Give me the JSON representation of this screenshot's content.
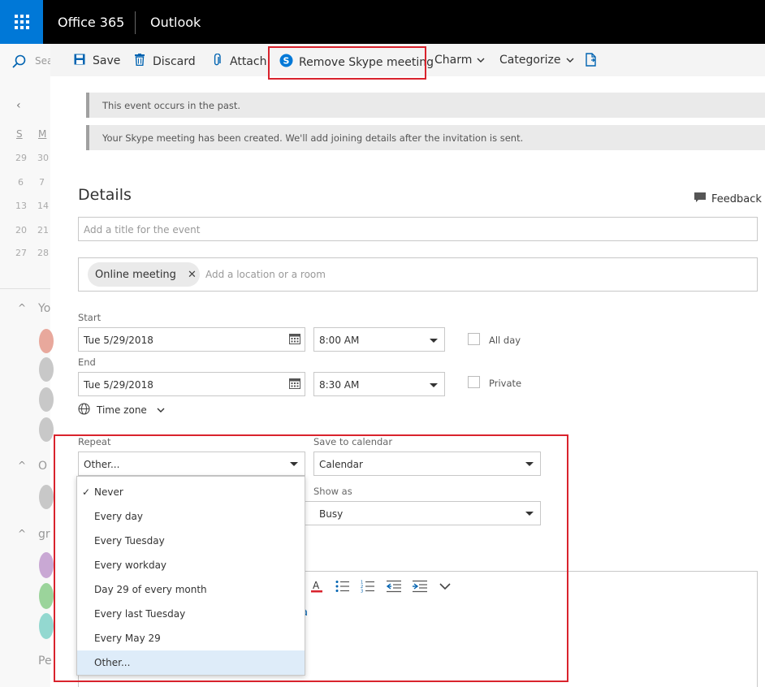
{
  "header": {
    "brand": "Office 365",
    "app": "Outlook"
  },
  "sidebar": {
    "search_placeholder": "Sea",
    "day_headers": [
      "S",
      "M"
    ],
    "mini_calendar_rows": [
      [
        "29",
        "30"
      ],
      [
        "6",
        "7"
      ],
      [
        "13",
        "14"
      ],
      [
        "20",
        "21"
      ],
      [
        "27",
        "28"
      ]
    ],
    "group_labels": [
      "Yo",
      "O",
      "gr"
    ],
    "people_label": "Pe"
  },
  "toolbar": {
    "save": "Save",
    "discard": "Discard",
    "attach": "Attach",
    "remove_skype": "Remove Skype meeting",
    "charm": "Charm",
    "categorize": "Categorize"
  },
  "infobars": [
    "This event occurs in the past.",
    "Your Skype meeting has been created. We'll add joining details after the invitation is sent."
  ],
  "details": {
    "heading": "Details",
    "feedback": "Feedback",
    "title_placeholder": "Add a title for the event",
    "location_chip": "Online meeting",
    "location_placeholder": "Add a location or a room",
    "start_label": "Start",
    "start_date": "Tue 5/29/2018",
    "start_time": "8:00 AM",
    "all_day": "All day",
    "end_label": "End",
    "end_date": "Tue 5/29/2018",
    "end_time": "8:30 AM",
    "private": "Private",
    "time_zone": "Time zone",
    "repeat_label": "Repeat",
    "repeat_value": "Other...",
    "save_to_label": "Save to calendar",
    "save_to_value": "Calendar",
    "show_as_label": "Show as",
    "show_as_value": "Busy",
    "body_link_fragment": "a"
  },
  "repeat_options": [
    {
      "label": "Never",
      "checked": true
    },
    {
      "label": "Every day"
    },
    {
      "label": "Every Tuesday"
    },
    {
      "label": "Every workday"
    },
    {
      "label": "Day 29 of every month"
    },
    {
      "label": "Every last Tuesday"
    },
    {
      "label": "Every May 29"
    },
    {
      "label": "Other...",
      "highlighted": true
    }
  ],
  "colors": {
    "accent": "#0078d7",
    "highlight_box": "#d9232d",
    "selected_option": "#deecf9"
  }
}
